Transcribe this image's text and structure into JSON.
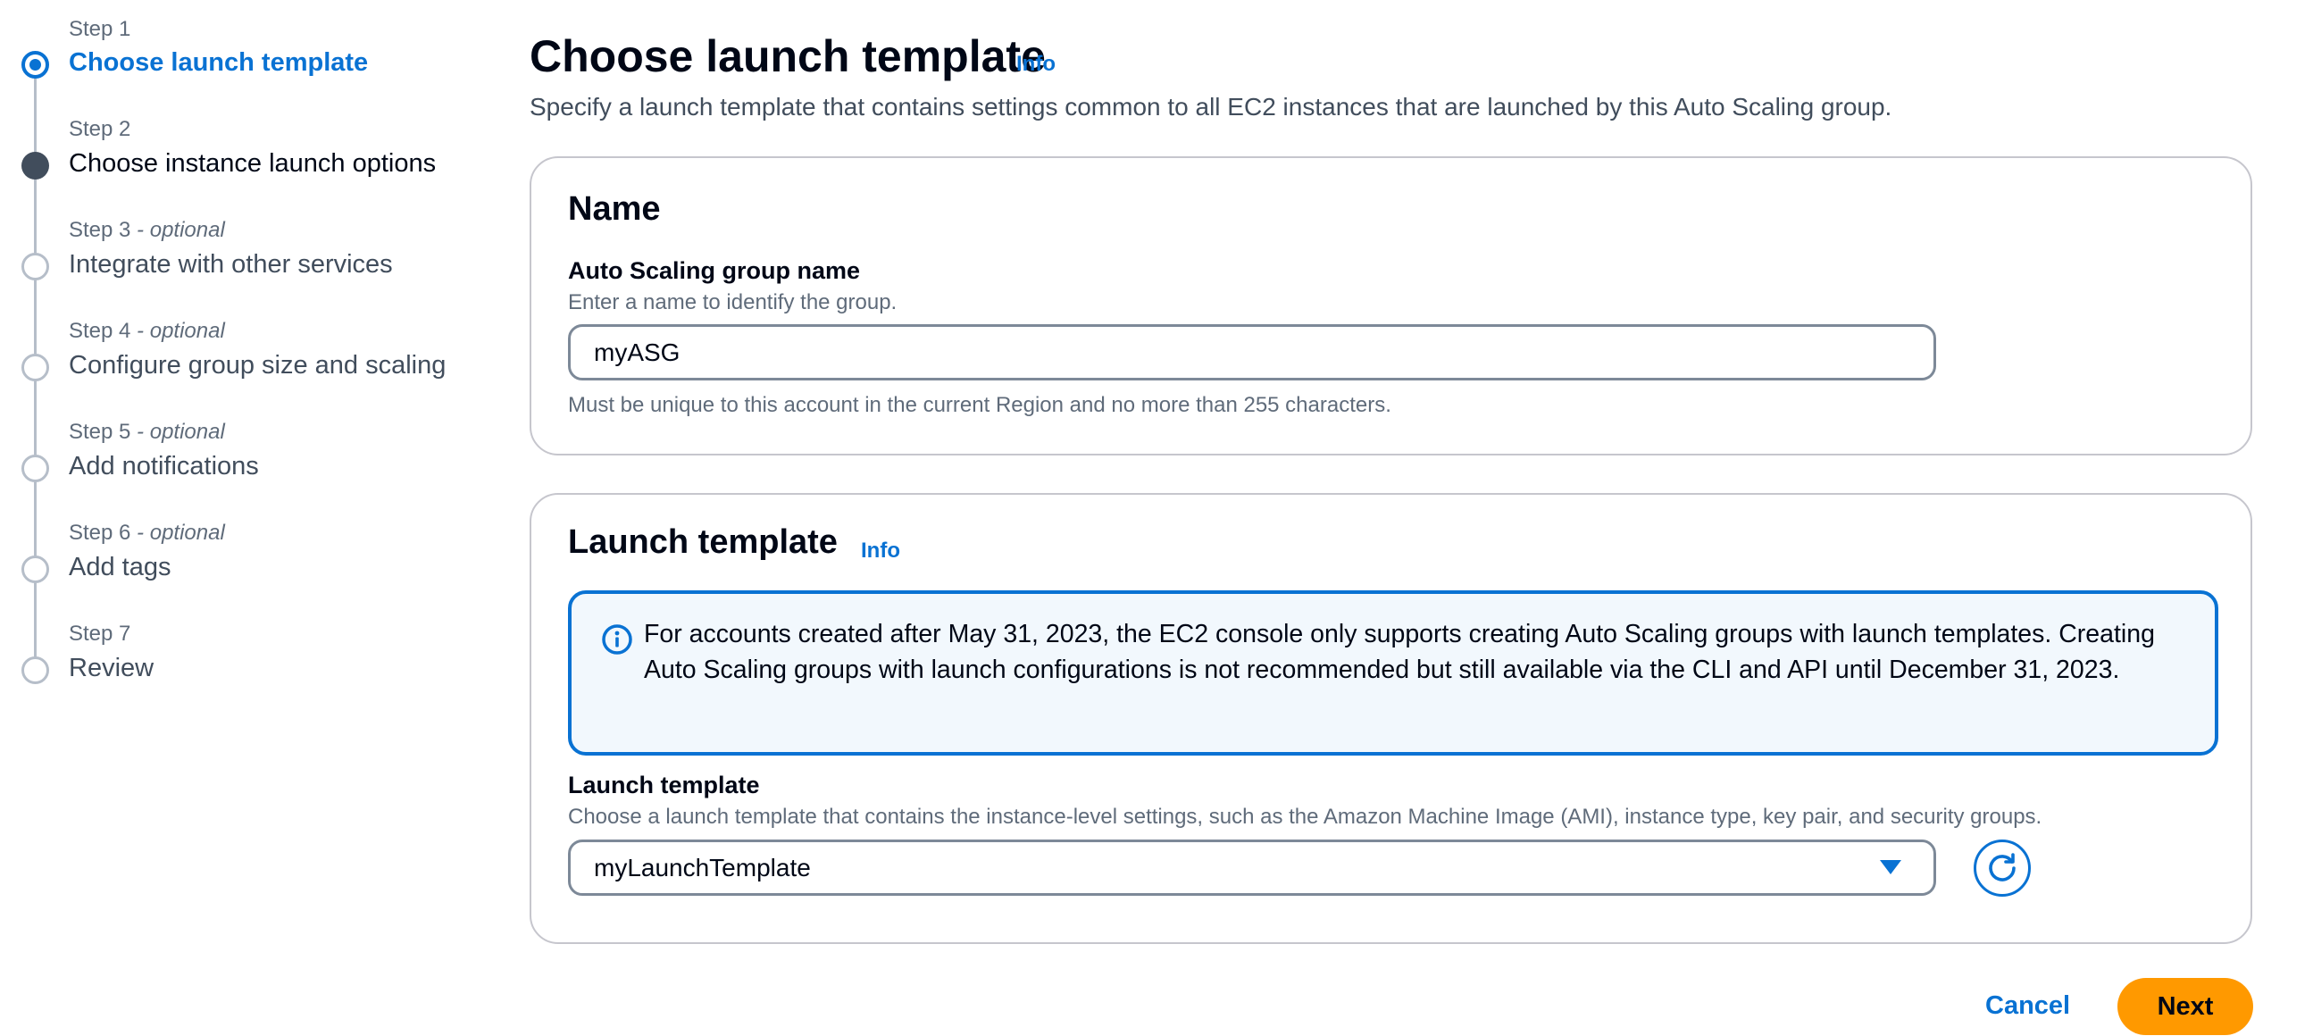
{
  "wizard": {
    "steps": [
      {
        "label": "Step 1",
        "optional": "",
        "title": "Choose launch template",
        "state": "current"
      },
      {
        "label": "Step 2",
        "optional": "",
        "title": "Choose instance launch options",
        "state": "visited"
      },
      {
        "label": "Step 3",
        "optional": " - optional",
        "title": "Integrate with other services",
        "state": "pending"
      },
      {
        "label": "Step 4",
        "optional": " - optional",
        "title": "Configure group size and scaling",
        "state": "pending"
      },
      {
        "label": "Step 5",
        "optional": " - optional",
        "title": "Add notifications",
        "state": "pending"
      },
      {
        "label": "Step 6",
        "optional": " - optional",
        "title": "Add tags",
        "state": "pending"
      },
      {
        "label": "Step 7",
        "optional": "",
        "title": "Review",
        "state": "pending"
      }
    ]
  },
  "page": {
    "title": "Choose launch template",
    "info": "Info",
    "description": "Specify a launch template that contains settings common to all EC2 instances that are launched by this Auto Scaling group."
  },
  "name_section": {
    "heading": "Name",
    "field_label": "Auto Scaling group name",
    "field_description": "Enter a name to identify the group.",
    "value": "myASG",
    "constraint": "Must be unique to this account in the current Region and no more than 255 characters."
  },
  "launch_template_section": {
    "heading": "Launch template",
    "info": "Info",
    "alert_text": "For accounts created after May 31, 2023, the EC2 console only supports creating Auto Scaling groups with launch templates. Creating Auto Scaling groups with launch configurations is not recommended but still available via the CLI and API until December 31, 2023.",
    "field_label": "Launch template",
    "field_description": "Choose a launch template that contains the instance-level settings, such as the Amazon Machine Image (AMI), instance type, key pair, and security groups.",
    "selected": "myLaunchTemplate"
  },
  "actions": {
    "cancel": "Cancel",
    "next": "Next"
  },
  "colors": {
    "accent": "#0972d3",
    "primary_button": "#ff9900",
    "alert_background": "#f2f8fd"
  },
  "icons": {
    "alert": "info-circle-icon",
    "refresh": "refresh-icon",
    "select": "caret-down-icon"
  }
}
